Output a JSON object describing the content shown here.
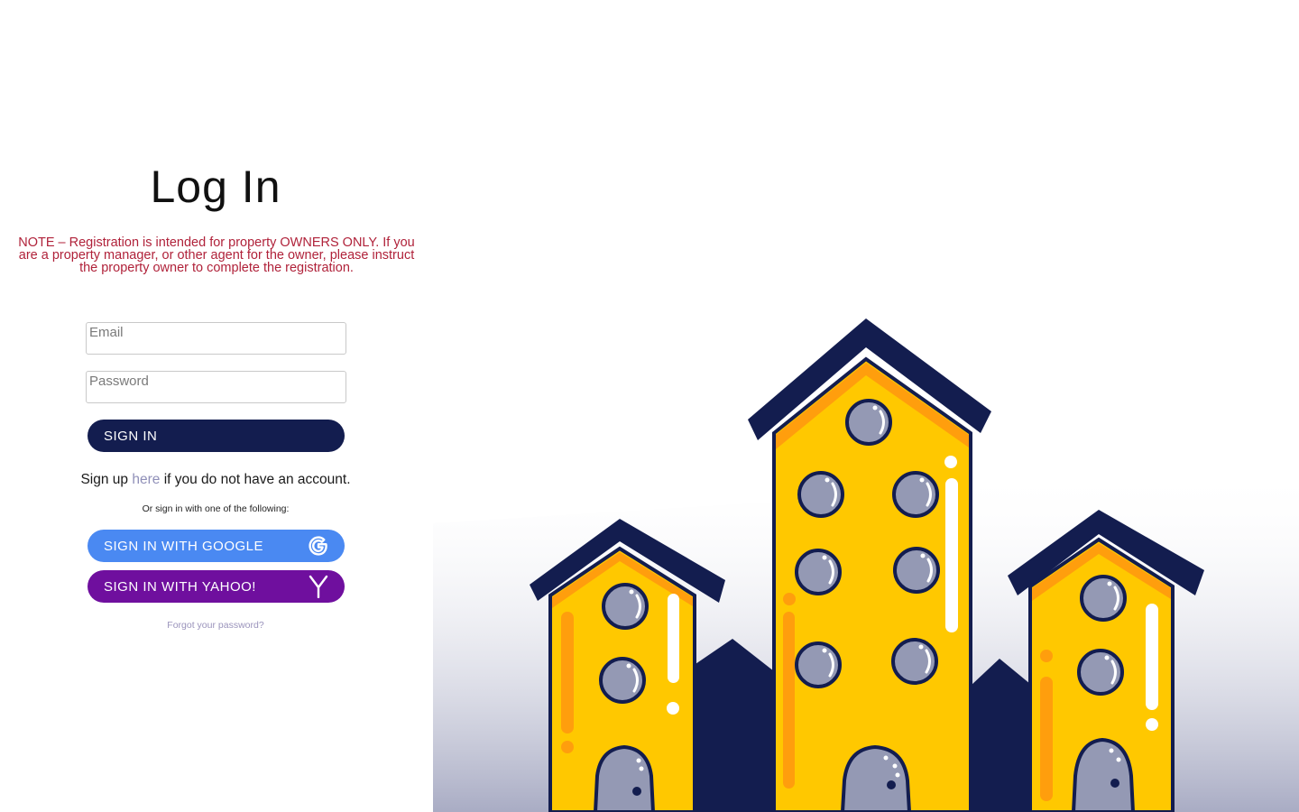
{
  "login": {
    "title": "Log In",
    "note": "NOTE – Registration is intended for property OWNERS ONLY. If you are a property manager, or other agent for the owner, please instruct the property owner to complete the registration.",
    "email_placeholder": "Email",
    "password_placeholder": "Password",
    "signin_label": "SIGN IN",
    "signup_prefix": "Sign up",
    "signup_link": "here",
    "signup_suffix": "if you do not have an account.",
    "alt_signin_text": "Or sign in with one of the following:",
    "google_label": "SIGN IN WITH GOOGLE",
    "yahoo_label": "SIGN IN WITH YAHOO!",
    "forgot_label": "Forgot your password?"
  },
  "icons": {
    "google": "google-g-icon",
    "yahoo": "yahoo-y-icon"
  },
  "colors": {
    "signin_button": "#131d4f",
    "google_button": "#4a89f2",
    "yahoo_button": "#6f0f9e",
    "note_text": "#b0223a",
    "building_yellow": "#ffc800",
    "building_orange": "#ff9e0d",
    "roof_navy": "#131d4f",
    "window_gray": "#9499b4"
  }
}
